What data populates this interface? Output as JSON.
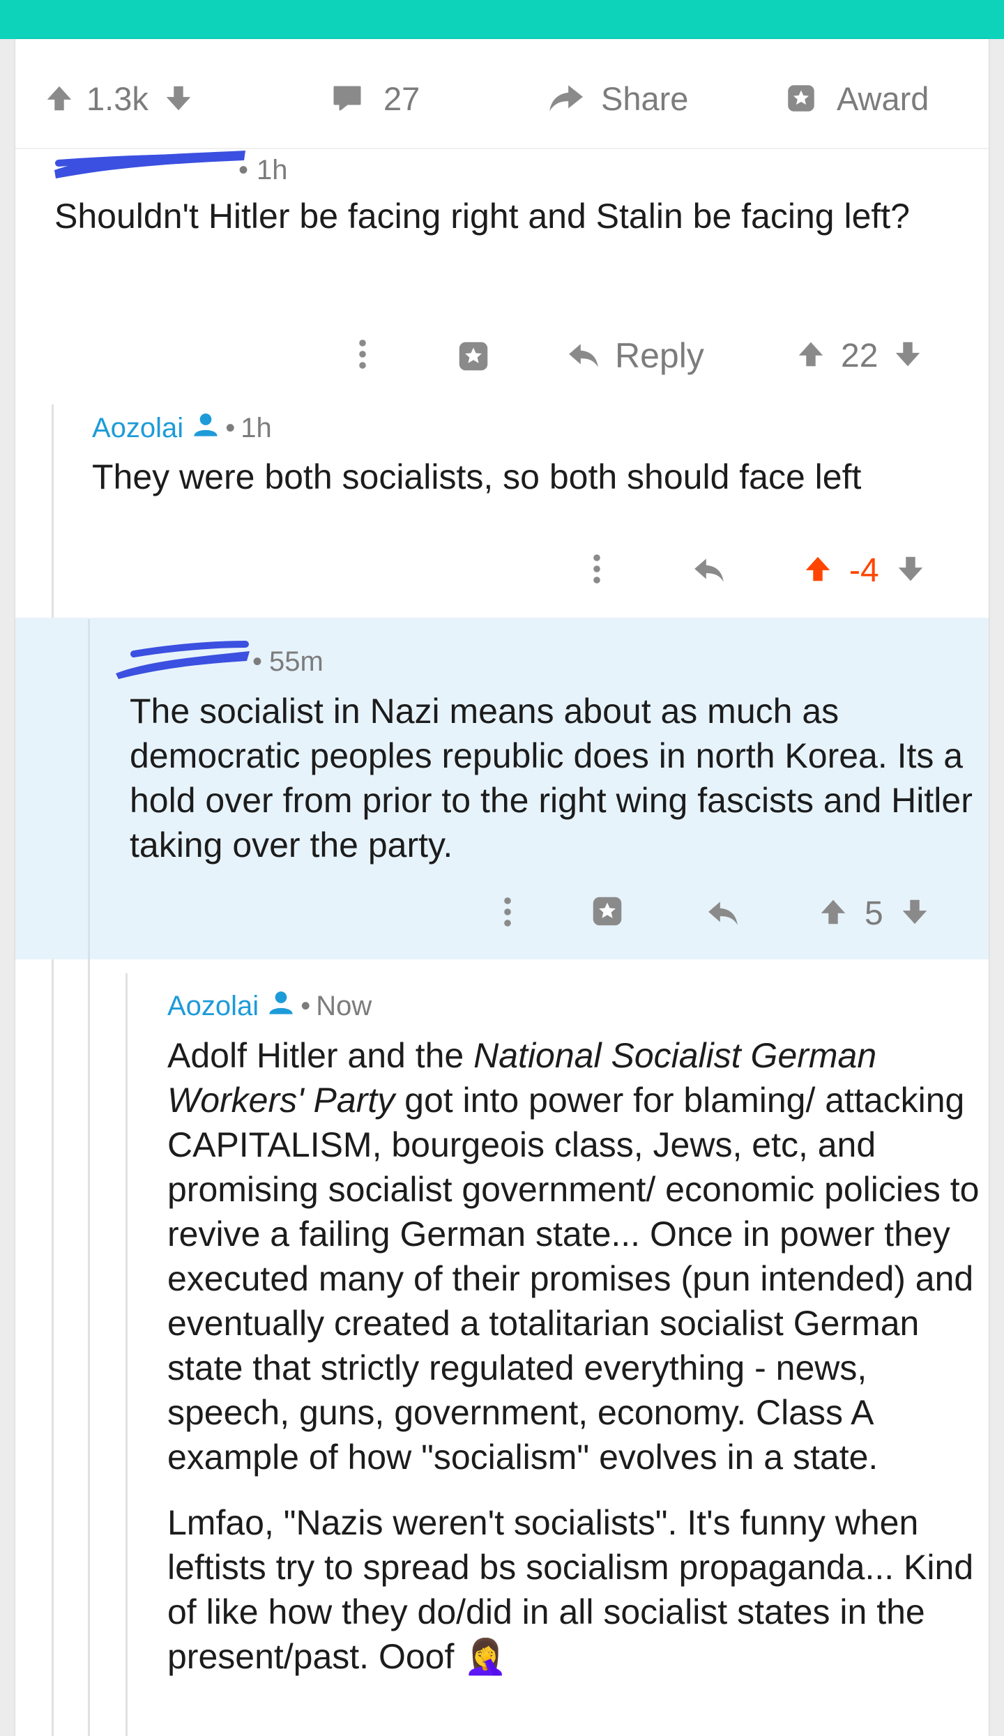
{
  "post_actions": {
    "upvotes": "1.3k",
    "comments": "27",
    "share_label": "Share",
    "award_label": "Award"
  },
  "comments": [
    {
      "author": "",
      "age": "1h",
      "body": "Shouldn't Hitler be facing right and Stalin be facing left?",
      "reply_label": "Reply",
      "score": "22"
    },
    {
      "author": "Aozolai",
      "age": "1h",
      "body": "They were both socialists, so both should face left",
      "score": "-4",
      "upvoted": true
    },
    {
      "author": "",
      "age": "55m",
      "body": "The socialist in Nazi means about as much as democratic peoples republic does in north Korea. Its a hold over from prior to the right wing fascists and Hitler taking over the party.",
      "score": "5",
      "highlighted": true
    },
    {
      "author": "Aozolai",
      "age": "Now",
      "body_p1_pre": "Adolf Hitler and the ",
      "body_p1_italic": "National Socialist German Workers' Party",
      "body_p1_post": " got into power for blaming/ attacking CAPITALISM, bourgeois class, Jews, etc, and promising socialist government/ economic policies to revive a failing German state... Once in power they executed many of their promises (pun intended) and eventually created a totalitarian socialist German state that strictly regulated everything - news, speech, guns, government, economy. Class A example of how \"socialism\" evolves in a state.",
      "body_p2": "Lmfao, \"Nazis weren't socialists\". It's funny when leftists try to spread bs socialism propaganda... Kind of like how they do/did in all socialist states in the present/past. Ooof",
      "emoji": "🤦‍♀️"
    }
  ],
  "colors": {
    "accent_bar": "#0dd3bb",
    "author_link": "#1d9bd8",
    "upvote_active": "#ff4500",
    "highlight_bg": "#e7f3fb",
    "redaction": "#3b50e0"
  }
}
